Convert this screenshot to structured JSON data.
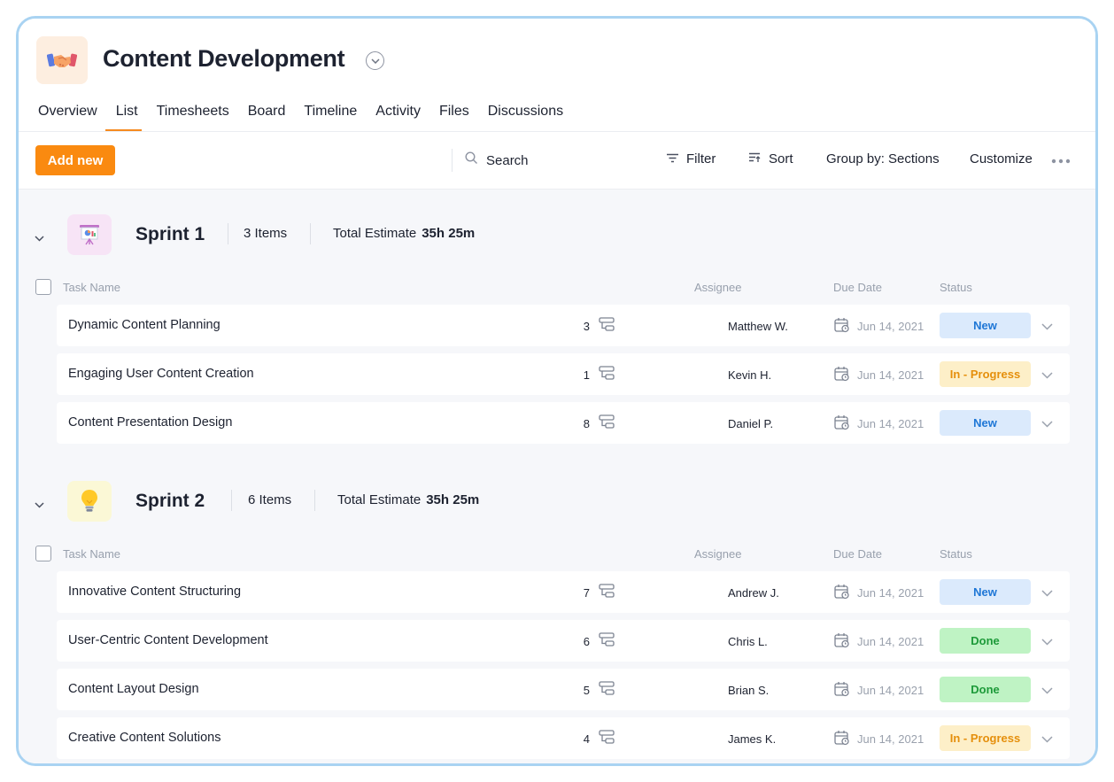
{
  "project": {
    "title": "Content Development"
  },
  "tabs": [
    "Overview",
    "List",
    "Timesheets",
    "Board",
    "Timeline",
    "Activity",
    "Files",
    "Discussions"
  ],
  "toolbar": {
    "add_label": "Add new",
    "search_placeholder": "Search",
    "filter_label": "Filter",
    "sort_label": "Sort",
    "group_label": "Group by: Sections",
    "customize_label": "Customize"
  },
  "columns": {
    "task": "Task Name",
    "assignee": "Assignee",
    "due": "Due Date",
    "status": "Status"
  },
  "colors": {
    "accent": "#fa8a10",
    "new": "#1f77d6",
    "in_progress": "#e58f0c",
    "done": "#1d9a39"
  },
  "sections": [
    {
      "title": "Sprint 1",
      "count": "3 Items",
      "estimate_label": "Total Estimate",
      "estimate_value": "35h 25m",
      "icon": "presentation-icon",
      "tasks": [
        {
          "name": "Dynamic Content Planning",
          "subtasks": "3",
          "assignee": "Matthew W.",
          "due": "Jun 14, 2021",
          "status": "New",
          "status_type": "new"
        },
        {
          "name": "Engaging User Content Creation",
          "subtasks": "1",
          "assignee": "Kevin H.",
          "due": "Jun 14, 2021",
          "status": "In - Progress",
          "status_type": "progress"
        },
        {
          "name": "Content Presentation Design",
          "subtasks": "8",
          "assignee": "Daniel P.",
          "due": "Jun 14, 2021",
          "status": "New",
          "status_type": "new"
        }
      ]
    },
    {
      "title": "Sprint 2",
      "count": "6 Items",
      "estimate_label": "Total Estimate",
      "estimate_value": "35h 25m",
      "icon": "lightbulb-icon",
      "tasks": [
        {
          "name": "Innovative Content Structuring",
          "subtasks": "7",
          "assignee": "Andrew J.",
          "due": "Jun 14, 2021",
          "status": "New",
          "status_type": "new"
        },
        {
          "name": "User-Centric Content Development",
          "subtasks": "6",
          "assignee": "Chris L.",
          "due": "Jun 14, 2021",
          "status": "Done",
          "status_type": "done"
        },
        {
          "name": "Content Layout Design",
          "subtasks": "5",
          "assignee": "Brian S.",
          "due": "Jun 14, 2021",
          "status": "Done",
          "status_type": "done"
        },
        {
          "name": "Creative Content Solutions",
          "subtasks": "4",
          "assignee": "James K.",
          "due": "Jun 14, 2021",
          "status": "In - Progress",
          "status_type": "progress"
        }
      ]
    }
  ]
}
